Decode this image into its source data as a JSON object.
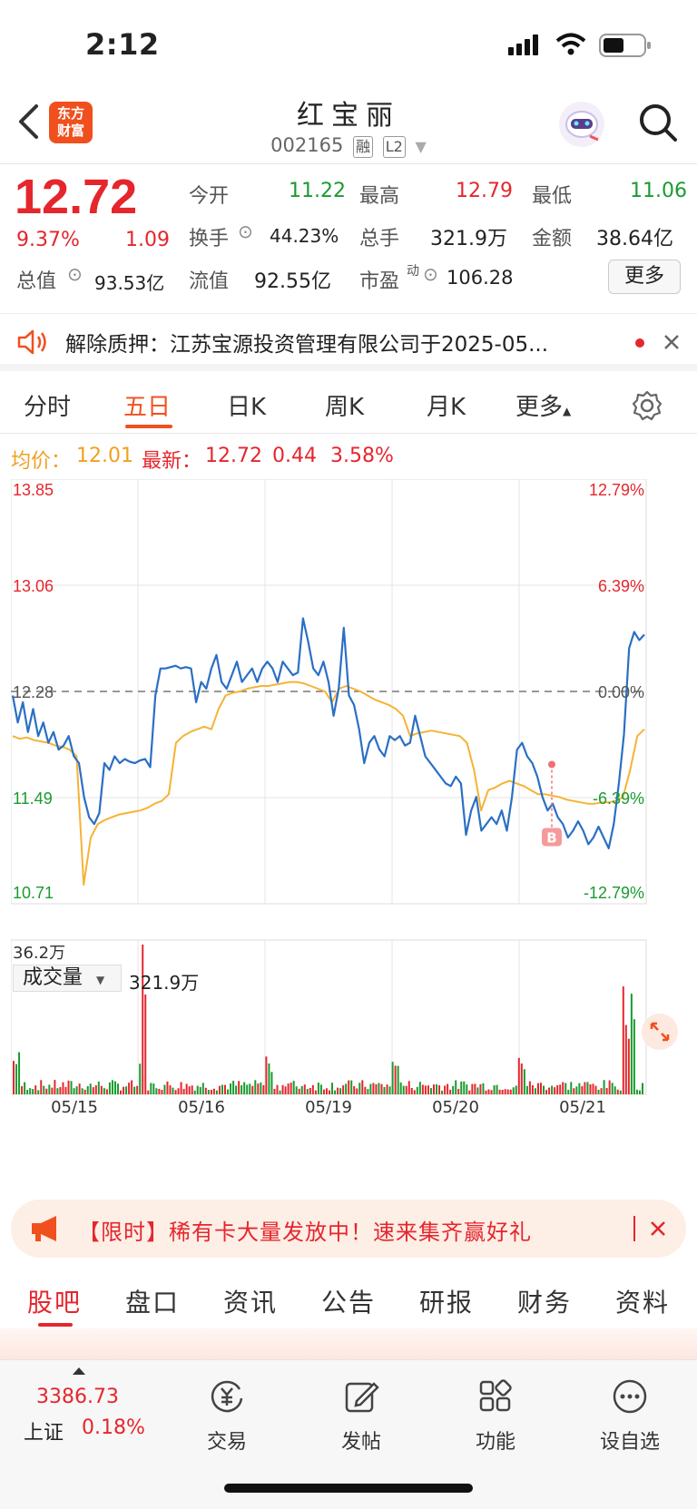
{
  "status_bar": {
    "time": "2:12"
  },
  "header": {
    "logo_line1": "东方",
    "logo_line2": "财富",
    "title": "红宝丽",
    "code": "002165",
    "tag1": "融",
    "tag2": "L2"
  },
  "quote": {
    "price": "12.72",
    "change_pct": "9.37%",
    "change": "1.09",
    "open_label": "今开",
    "open": "11.22",
    "high_label": "最高",
    "high": "12.79",
    "low_label": "最低",
    "low": "11.06",
    "turnover_label": "换手",
    "turnover": "44.23%",
    "volume_label": "总手",
    "volume": "321.9万",
    "amount_label": "金额",
    "amount": "38.64亿",
    "mktcap_label": "总值",
    "mktcap": "93.53亿",
    "float_label": "流值",
    "float": "92.55亿",
    "pe_label": "市盈",
    "pe_sup": "动",
    "pe": "106.28",
    "more": "更多"
  },
  "notice": {
    "text": "解除质押：江苏宝源投资管理有限公司于2025-05..."
  },
  "tabs": [
    "分时",
    "五日",
    "日K",
    "周K",
    "月K",
    "更多"
  ],
  "info_line": {
    "avg_label": "均价：",
    "avg": "12.01",
    "latest_label": "最新：",
    "latest": "12.72",
    "delta": "0.44",
    "delta_pct": "3.58%"
  },
  "chart_data": {
    "type": "line",
    "x_labels": [
      "05/15",
      "05/16",
      "05/19",
      "05/20",
      "05/21"
    ],
    "ylim": [
      10.71,
      13.85
    ],
    "y_ticks_left": [
      "13.85",
      "13.06",
      "12.28",
      "11.49",
      "10.71"
    ],
    "y_ticks_right": [
      "12.79%",
      "6.39%",
      "0.00%",
      "-6.39%",
      "-12.79%"
    ],
    "prev_close": 12.28,
    "series": [
      {
        "values": [
          12.25,
          12.05,
          12.2,
          11.98,
          12.15,
          11.95,
          12.05,
          11.9,
          11.98,
          11.85,
          11.88,
          11.95,
          11.8,
          11.75,
          11.5,
          11.35,
          11.3,
          11.38,
          11.75,
          11.7,
          11.8,
          11.75,
          11.78,
          11.76,
          11.75,
          11.77,
          11.78,
          11.72,
          12.25,
          12.45,
          12.45,
          12.46,
          12.47,
          12.45,
          12.46,
          12.45,
          12.2,
          12.35,
          12.3,
          12.45,
          12.55,
          12.35,
          12.3,
          12.4,
          12.5,
          12.35,
          12.4,
          12.45,
          12.35,
          12.45,
          12.5,
          12.45,
          12.35,
          12.5,
          12.45,
          12.4,
          12.42,
          12.82,
          12.65,
          12.45,
          12.4,
          12.5,
          12.35,
          12.1,
          12.3,
          12.75,
          12.25,
          12.18,
          12.0,
          11.75,
          11.9,
          11.95,
          11.85,
          11.8,
          11.95,
          11.92,
          11.95,
          11.88,
          11.9,
          12.1,
          11.95,
          11.8,
          11.75,
          11.7,
          11.65,
          11.6,
          11.58,
          11.65,
          11.6,
          11.22,
          11.4,
          11.5,
          11.25,
          11.3,
          11.35,
          11.3,
          11.4,
          11.25,
          11.5,
          11.85,
          11.9,
          11.8,
          11.75,
          11.65,
          11.5,
          11.4,
          11.45,
          11.35,
          11.3,
          11.2,
          11.25,
          11.32,
          11.25,
          11.15,
          11.2,
          11.28,
          11.2,
          11.12,
          11.3,
          11.6,
          11.96,
          12.6,
          12.72,
          12.66,
          12.7
        ]
      },
      {
        "values": [
          11.95,
          11.93,
          11.94,
          11.92,
          11.91,
          11.9,
          11.88,
          11.87,
          11.85,
          11.8,
          10.85,
          11.2,
          11.3,
          11.33,
          11.35,
          11.37,
          11.38,
          11.39,
          11.4,
          11.42,
          11.45,
          11.47,
          11.52,
          11.9,
          11.95,
          11.98,
          12.0,
          12.02,
          12.0,
          12.15,
          12.25,
          12.27,
          12.28,
          12.3,
          12.31,
          12.32,
          12.32,
          12.33,
          12.34,
          12.35,
          12.35,
          12.34,
          12.32,
          12.3,
          12.28,
          12.2,
          12.3,
          12.32,
          12.3,
          12.28,
          12.25,
          12.22,
          12.2,
          12.18,
          12.15,
          12.1,
          11.95,
          11.97,
          11.98,
          11.99,
          11.98,
          11.97,
          11.96,
          11.95,
          11.9,
          11.7,
          11.4,
          11.55,
          11.57,
          11.6,
          11.62,
          11.6,
          11.58,
          11.55,
          11.52,
          11.52,
          11.51,
          11.5,
          11.48,
          11.47,
          11.46,
          11.45,
          11.45,
          11.46,
          11.46,
          11.47,
          11.5,
          11.7,
          11.95,
          12.0
        ]
      }
    ],
    "volume_label": "成交量",
    "volume_total": "321.9万",
    "volume_max_label": "36.2万",
    "buy_marker": "B"
  },
  "banner": {
    "text": "【限时】稀有卡大量发放中！速来集齐赢好礼"
  },
  "subtabs": [
    "股吧",
    "盘口",
    "资讯",
    "公告",
    "研报",
    "财务",
    "资料"
  ],
  "bottom": {
    "index_value": "3386.73",
    "index_name": "上证",
    "index_pct": "0.18%",
    "items": [
      "交易",
      "发帖",
      "功能",
      "设自选"
    ]
  }
}
